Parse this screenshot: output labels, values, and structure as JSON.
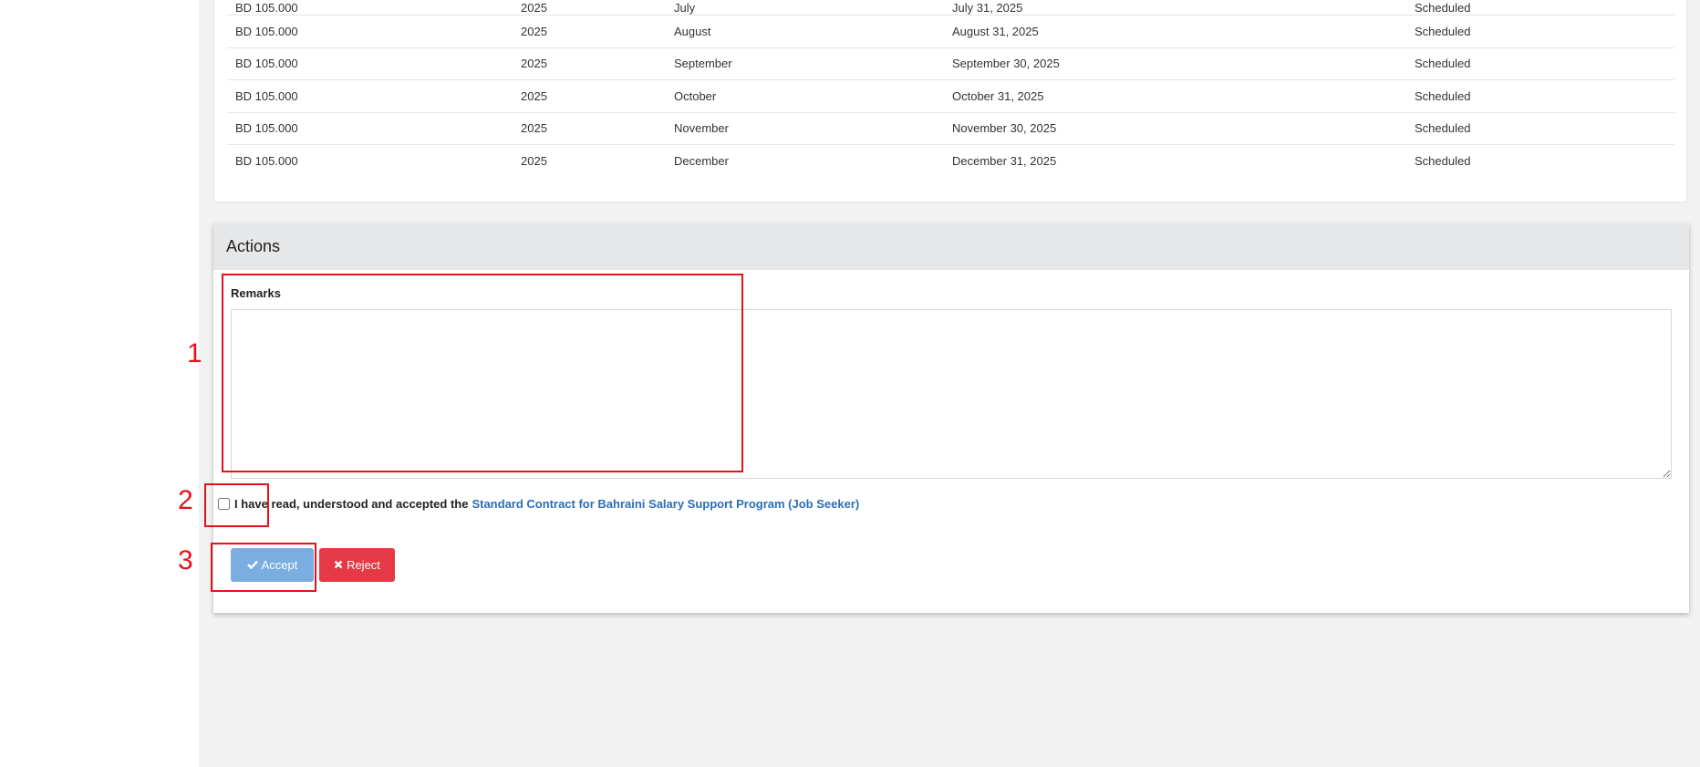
{
  "schedule": {
    "partial_row": {
      "amount": "BD 105.000",
      "year": "2025",
      "month": "July",
      "due_date": "July 31, 2025",
      "status": "Scheduled"
    },
    "rows": [
      {
        "amount": "BD 105.000",
        "year": "2025",
        "month": "August",
        "due_date": "August 31, 2025",
        "status": "Scheduled"
      },
      {
        "amount": "BD 105.000",
        "year": "2025",
        "month": "September",
        "due_date": "September 30, 2025",
        "status": "Scheduled"
      },
      {
        "amount": "BD 105.000",
        "year": "2025",
        "month": "October",
        "due_date": "October 31, 2025",
        "status": "Scheduled"
      },
      {
        "amount": "BD 105.000",
        "year": "2025",
        "month": "November",
        "due_date": "November 30, 2025",
        "status": "Scheduled"
      },
      {
        "amount": "BD 105.000",
        "year": "2025",
        "month": "December",
        "due_date": "December 31, 2025",
        "status": "Scheduled"
      }
    ]
  },
  "actions": {
    "title": "Actions",
    "remarks_label": "Remarks",
    "remarks_value": "",
    "agreement_text": "I have read, understood and accepted the",
    "agreement_link": "Standard Contract for Bahraini Salary Support Program (Job Seeker)",
    "accept_label": "Accept",
    "reject_label": "Reject"
  },
  "annotations": [
    "1",
    "2",
    "3"
  ],
  "colors": {
    "accept_button": "#7aade0",
    "reject_button": "#e53945",
    "link": "#2a6ebb",
    "annotation": "#e8101b"
  }
}
